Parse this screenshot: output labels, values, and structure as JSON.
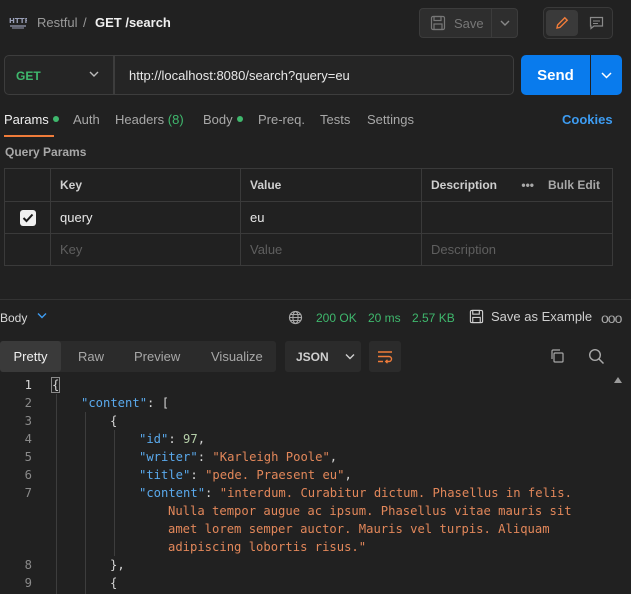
{
  "header": {
    "parent": "Restful",
    "separator": "/",
    "title": "GET /search",
    "save_label": "Save"
  },
  "request": {
    "method": "GET",
    "url": "http://localhost:8080/search?query=eu",
    "send_label": "Send"
  },
  "tabs": {
    "params": "Params",
    "auth": "Auth",
    "headers": "Headers",
    "headers_count": "(8)",
    "body": "Body",
    "prereq": "Pre-req.",
    "tests": "Tests",
    "settings": "Settings",
    "cookies": "Cookies"
  },
  "query_params": {
    "title": "Query Params",
    "columns": {
      "key": "Key",
      "value": "Value",
      "description": "Description"
    },
    "bulk_edit": "Bulk Edit",
    "more": "•••",
    "rows": [
      {
        "key": "query",
        "value": "eu",
        "checked": true
      }
    ],
    "placeholder": {
      "key": "Key",
      "value": "Value",
      "description": "Description"
    }
  },
  "response": {
    "label": "Body",
    "status": "200 OK",
    "time": "20 ms",
    "size": "2.57 KB",
    "save_example": "Save as Example",
    "more": "ooo",
    "formats": {
      "pretty": "Pretty",
      "raw": "Raw",
      "preview": "Preview",
      "visualize": "Visualize"
    },
    "language": "JSON"
  },
  "code": {
    "line_numbers": [
      "1",
      "2",
      "3",
      "4",
      "5",
      "6",
      "7",
      "8",
      "9"
    ],
    "l1": "{",
    "l2_key": "\"content\"",
    "l2_rest": ": [",
    "l3": "{",
    "l4_key": "\"id\"",
    "l4_colon": ": ",
    "l4_val": "97",
    "l4_end": ",",
    "l5_key": "\"writer\"",
    "l5_colon": ": ",
    "l5_val": "\"Karleigh Poole\"",
    "l5_end": ",",
    "l6_key": "\"title\"",
    "l6_colon": ": ",
    "l6_val": "\"pede. Praesent eu\"",
    "l6_end": ",",
    "l7_key": "\"content\"",
    "l7_colon": ": ",
    "l7_val_1": "\"interdum. Curabitur dictum. Phasellus in felis.",
    "l7_val_2": "Nulla tempor augue ac ipsum. Phasellus vitae mauris sit",
    "l7_val_3": "amet lorem semper auctor. Mauris vel turpis. Aliquam",
    "l7_val_4": "adipiscing lobortis risus.\"",
    "l8": "},",
    "l9": "{"
  }
}
